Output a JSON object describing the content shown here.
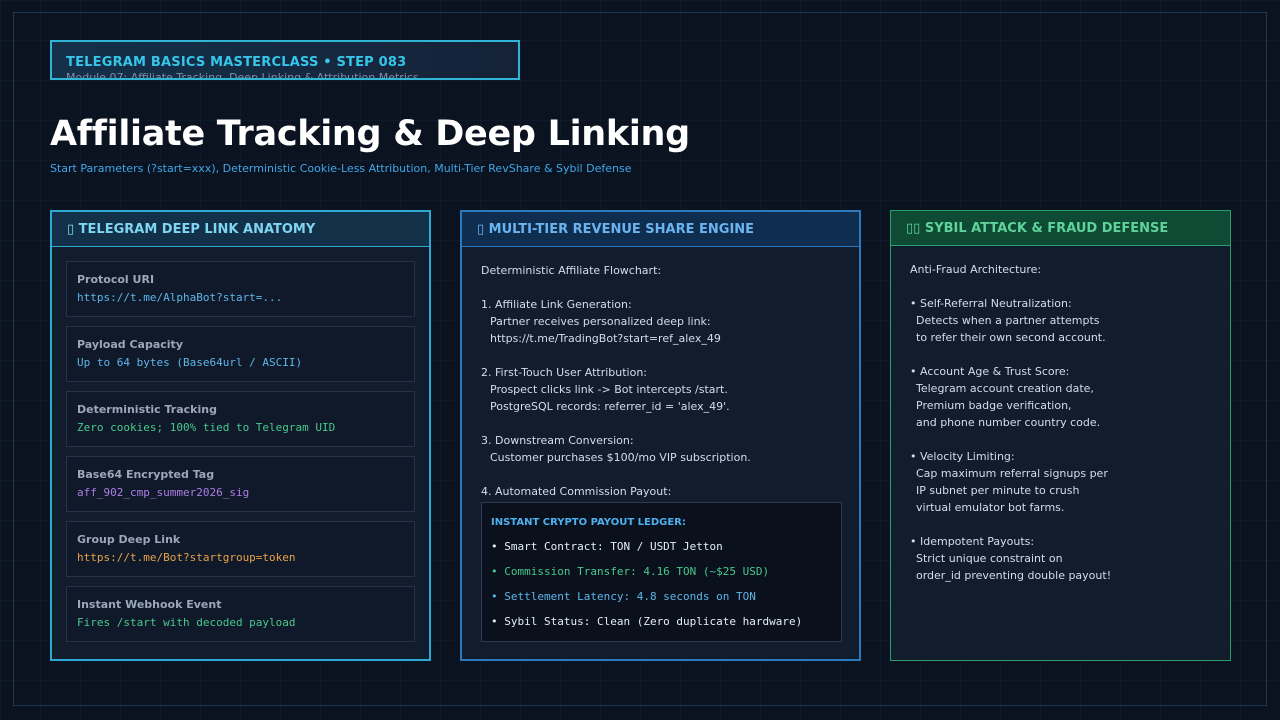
{
  "header": {
    "step_title": "TELEGRAM BASICS MASTERCLASS • STEP 083",
    "module": "Module 07: Affiliate Tracking, Deep Linking & Attribution Metrics",
    "title": "Affiliate Tracking & Deep Linking",
    "subtitle": "Start Parameters (?start=xxx), Deterministic Cookie-Less Attribution, Multi-Tier RevShare & Sybil Defense"
  },
  "anatomy": {
    "heading": "▯ TELEGRAM DEEP LINK ANATOMY",
    "cards": [
      {
        "label": "Protocol URI",
        "value": "https://t.me/AlphaBot?start=...",
        "color": "#5fb5e8"
      },
      {
        "label": "Payload Capacity",
        "value": "Up to 64 bytes (Base64url / ASCII)",
        "color": "#5fb5e8"
      },
      {
        "label": "Deterministic Tracking",
        "value": "Zero cookies; 100% tied to Telegram UID",
        "color": "#48c98c"
      },
      {
        "label": "Base64 Encrypted Tag",
        "value": "aff_902_cmp_summer2026_sig",
        "color": "#b07de8"
      },
      {
        "label": "Group Deep Link",
        "value": "https://t.me/Bot?startgroup=token",
        "color": "#e8a24a"
      },
      {
        "label": "Instant Webhook Event",
        "value": "Fires /start with decoded payload",
        "color": "#48c98c"
      }
    ]
  },
  "revshare": {
    "heading": "▯ MULTI-TIER REVENUE SHARE ENGINE",
    "intro": "Deterministic Affiliate Flowchart:",
    "steps": [
      {
        "title": "1. Affiliate Link Generation:",
        "lines": [
          "Partner receives personalized deep link:",
          "https://t.me/TradingBot?start=ref_alex_49"
        ]
      },
      {
        "title": "2. First-Touch User Attribution:",
        "lines": [
          "Prospect clicks link -> Bot intercepts /start.",
          "PostgreSQL records: referrer_id = 'alex_49'."
        ]
      },
      {
        "title": "3. Downstream Conversion:",
        "lines": [
          "Customer purchases $100/mo VIP subscription."
        ]
      },
      {
        "title": "4. Automated Commission Payout:",
        "lines": []
      }
    ],
    "ledger": {
      "title": "INSTANT CRYPTO PAYOUT LEDGER:",
      "rows": [
        {
          "text": "• Smart Contract: TON / USDT Jetton",
          "color": "#e6edf5"
        },
        {
          "text": "• Commission Transfer: 4.16 TON (~$25 USD)",
          "color": "#48c98c"
        },
        {
          "text": "• Settlement Latency: 4.8 seconds on TON",
          "color": "#5fb5e8"
        },
        {
          "text": "• Sybil Status: Clean (Zero duplicate hardware)",
          "color": "#e6edf5"
        }
      ]
    }
  },
  "sybil": {
    "heading": "▯▯ SYBIL ATTACK & FRAUD DEFENSE",
    "intro": "Anti-Fraud Architecture:",
    "items": [
      {
        "title": "• Self-Referral Neutralization:",
        "lines": [
          "Detects when a partner attempts",
          "to refer their own second account."
        ]
      },
      {
        "title": "• Account Age & Trust Score:",
        "lines": [
          "Telegram account creation date,",
          "Premium badge verification,",
          "and phone number country code."
        ]
      },
      {
        "title": "• Velocity Limiting:",
        "lines": [
          "Cap maximum referral signups per",
          "IP subnet per minute to crush",
          "virtual emulator bot farms."
        ]
      },
      {
        "title": "• Idempotent Payouts:",
        "lines": [
          "Strict unique constraint on",
          "order_id preventing double payout!"
        ]
      }
    ]
  }
}
